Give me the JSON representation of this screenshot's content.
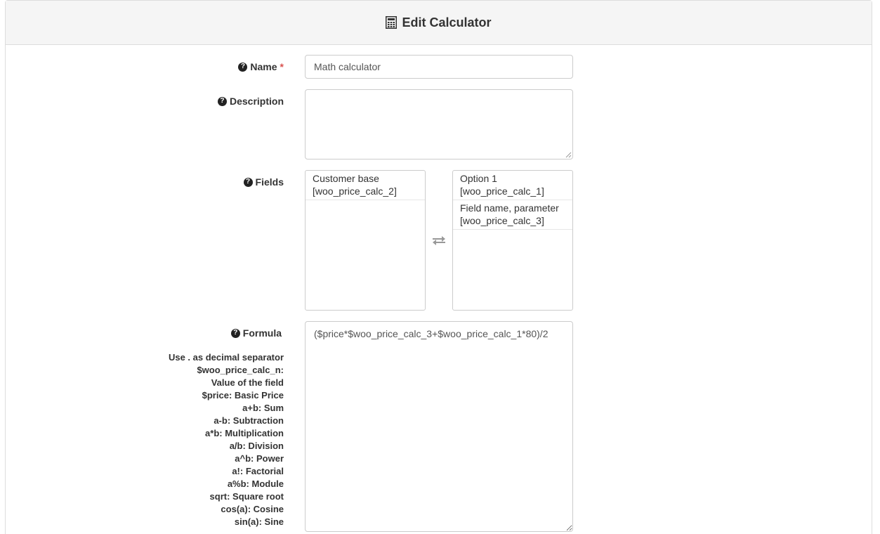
{
  "header": {
    "title": "Edit Calculator",
    "icon": "calculator-icon"
  },
  "form": {
    "name": {
      "label": "Name",
      "required_mark": "*",
      "value": "Math calculator"
    },
    "description": {
      "label": "Description",
      "value": ""
    },
    "fields": {
      "label": "Fields",
      "available": [
        {
          "line1": "Customer base",
          "line2": "[woo_price_calc_2]"
        }
      ],
      "selected": [
        {
          "line1": "Option 1",
          "line2": "[woo_price_calc_1]"
        },
        {
          "line1": "Field name, parameter",
          "line2": "[woo_price_calc_3]"
        }
      ],
      "swap_icon": "swap-arrows-icon"
    },
    "formula": {
      "label": "Formula",
      "value": "($price*$woo_price_calc_3+$woo_price_calc_1*80)/2",
      "help": [
        "Use . as decimal separator",
        "$woo_price_calc_n: Value of the field",
        "$price: Basic Price",
        "a+b: Sum",
        "a-b: Subtraction",
        "a*b: Multiplication",
        "a/b: Division",
        "a^b: Power",
        "a!: Factorial",
        "a%b: Module",
        "sqrt: Square root",
        "cos(a): Cosine",
        "sin(a): Sine"
      ]
    }
  },
  "icons": {
    "help": "question-circle-icon"
  }
}
